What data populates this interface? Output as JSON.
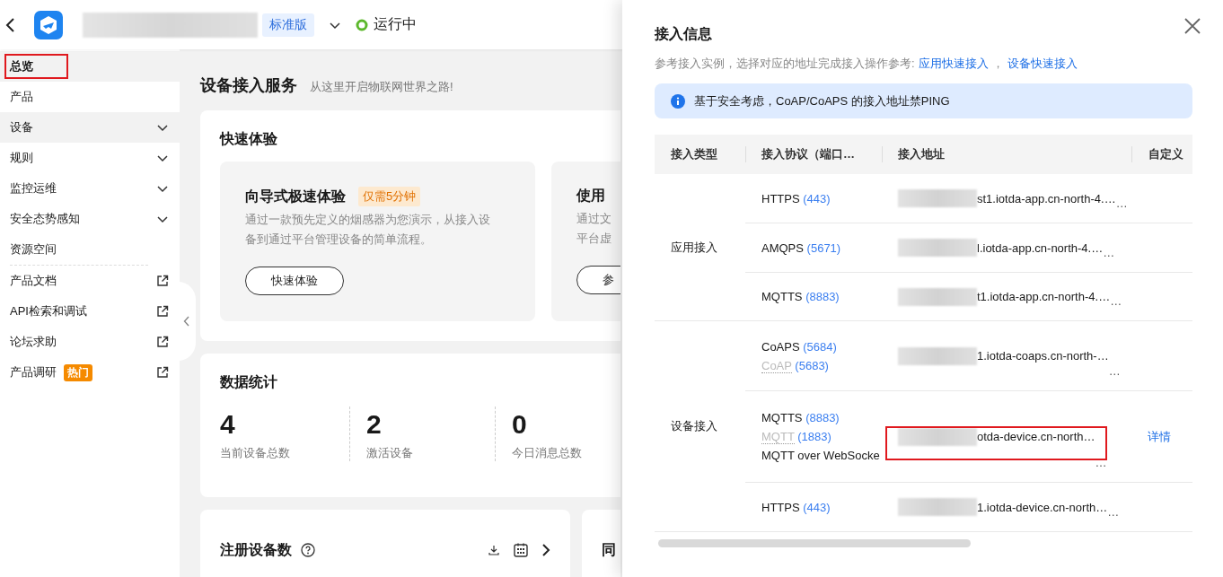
{
  "header": {
    "edition_badge": "标准版",
    "status": "运行中"
  },
  "sidebar": {
    "items": [
      {
        "label": "总览",
        "kind": "plain",
        "selected": true,
        "highlighted": true,
        "annotated": true
      },
      {
        "label": "产品",
        "kind": "plain",
        "selected": false,
        "highlighted": false,
        "annotated": false
      },
      {
        "label": "设备",
        "kind": "group",
        "selected": false,
        "highlighted": true,
        "annotated": false
      },
      {
        "label": "规则",
        "kind": "group",
        "selected": false,
        "highlighted": false,
        "annotated": false
      },
      {
        "label": "监控运维",
        "kind": "group",
        "selected": false,
        "highlighted": false,
        "annotated": false
      },
      {
        "label": "安全态势感知",
        "kind": "group",
        "selected": false,
        "highlighted": false,
        "annotated": false
      },
      {
        "label": "资源空间",
        "kind": "plain",
        "selected": false,
        "highlighted": false,
        "annotated": false
      },
      {
        "label": "产品文档",
        "kind": "external",
        "selected": false,
        "highlighted": false,
        "annotated": false
      },
      {
        "label": "API检索和调试",
        "kind": "external",
        "selected": false,
        "highlighted": false,
        "annotated": false
      },
      {
        "label": "论坛求助",
        "kind": "external",
        "selected": false,
        "highlighted": false,
        "annotated": false
      },
      {
        "label": "产品调研",
        "kind": "external",
        "badge": "热门",
        "selected": false,
        "highlighted": false,
        "annotated": false
      }
    ]
  },
  "main": {
    "title": "设备接入服务",
    "subtitle": "从这里开启物联网世界之路!",
    "quick": {
      "heading": "快速体验",
      "cards": [
        {
          "title": "向导式极速体验",
          "tag": "仅需5分钟",
          "description": [
            "通过一款预先定义的烟感器为您演示，从接入设",
            "备到通过平台管理设备的简单流程。"
          ],
          "button": "快速体验"
        },
        {
          "title": "使用",
          "description": [
            "通过文",
            "平台虚"
          ],
          "button": "参"
        }
      ]
    },
    "stats": {
      "heading": "数据统计",
      "items": [
        {
          "value": "4",
          "label": "当前设备总数"
        },
        {
          "value": "2",
          "label": "激活设备"
        },
        {
          "value": "0",
          "label": "今日消息总数"
        }
      ]
    },
    "panels": [
      {
        "title": "注册设备数",
        "tools": true
      },
      {
        "title": "同"
      }
    ]
  },
  "drawer": {
    "title": "接入信息",
    "intro": "参考接入实例，选择对应的地址完成接入操作参考:",
    "links": [
      "应用快速接入",
      "设备快速接入"
    ],
    "link_separator": "，",
    "notice": "基于安全考虑，CoAP/CoAPS 的接入地址禁PING",
    "table": {
      "columns": [
        "接入类型",
        "接入协议（端口…",
        "接入地址",
        "自定义"
      ],
      "groups": [
        {
          "type": "应用接入",
          "rows": [
            {
              "protocols": [
                {
                  "name": "HTTPS",
                  "port": "(443)",
                  "disabled": false
                }
              ],
              "address": "st1.iotda-app.cn-north-4.…",
              "more": "…",
              "annotated": false
            },
            {
              "protocols": [
                {
                  "name": "AMQPS",
                  "port": "(5671)",
                  "disabled": false
                }
              ],
              "address": "l.iotda-app.cn-north-4.…",
              "more": "…",
              "annotated": false
            },
            {
              "protocols": [
                {
                  "name": "MQTTS",
                  "port": "(8883)",
                  "disabled": false
                }
              ],
              "address": "t1.iotda-app.cn-north-4.…",
              "more": "…",
              "annotated": false
            }
          ]
        },
        {
          "type": "设备接入",
          "rows": [
            {
              "protocols": [
                {
                  "name": "CoAPS",
                  "port": "(5684)",
                  "disabled": false
                },
                {
                  "name": "CoAP",
                  "port": "(5683)",
                  "disabled": true
                }
              ],
              "address": "1.iotda-coaps.cn-north-…",
              "more": "…",
              "annotated": false
            },
            {
              "protocols": [
                {
                  "name": "MQTTS",
                  "port": "(8883)",
                  "disabled": false
                },
                {
                  "name": "MQTT",
                  "port": "(1883)",
                  "disabled": true
                },
                {
                  "name": "MQTT over WebSocke",
                  "disabled": false
                }
              ],
              "address": "otda-device.cn-north…",
              "more": "…",
              "action": "详情",
              "annotated": true
            },
            {
              "protocols": [
                {
                  "name": "HTTPS",
                  "port": "(443)",
                  "disabled": false
                }
              ],
              "address": "1.iotda-device.cn-north…",
              "more": "…",
              "annotated": false
            }
          ]
        }
      ]
    }
  }
}
